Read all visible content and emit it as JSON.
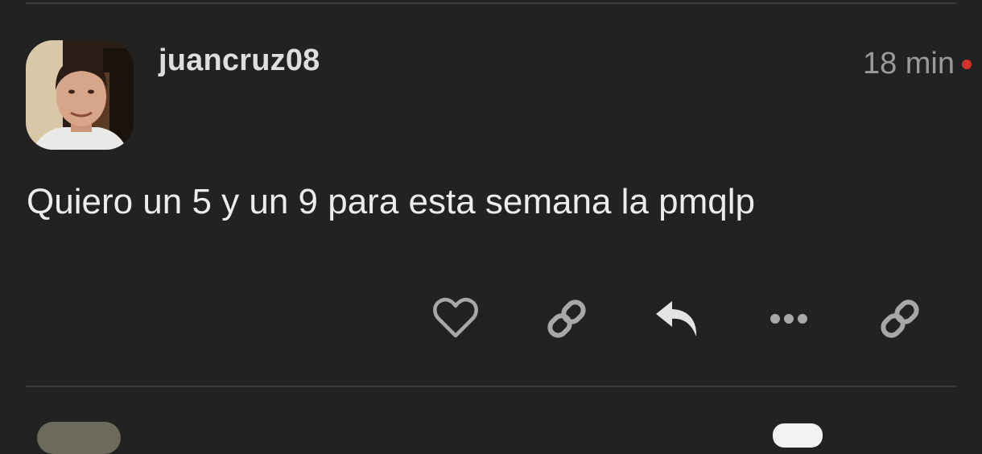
{
  "post": {
    "username": "juancruz08",
    "timestamp": "18 min",
    "body": "Quiero un 5 y un 9 para esta semana la pmqlp"
  },
  "actions": [
    {
      "name": "like-button",
      "icon": "heart-icon"
    },
    {
      "name": "copy-link-button",
      "icon": "link-icon"
    },
    {
      "name": "reply-button",
      "icon": "reply-icon"
    },
    {
      "name": "more-button",
      "icon": "ellipsis-icon"
    },
    {
      "name": "share-link-button",
      "icon": "link-icon"
    }
  ],
  "colors": {
    "background": "#222222",
    "icon": "#a8a8a8",
    "reply_icon": "#e4e4e4",
    "unread_dot": "#d6322b"
  }
}
